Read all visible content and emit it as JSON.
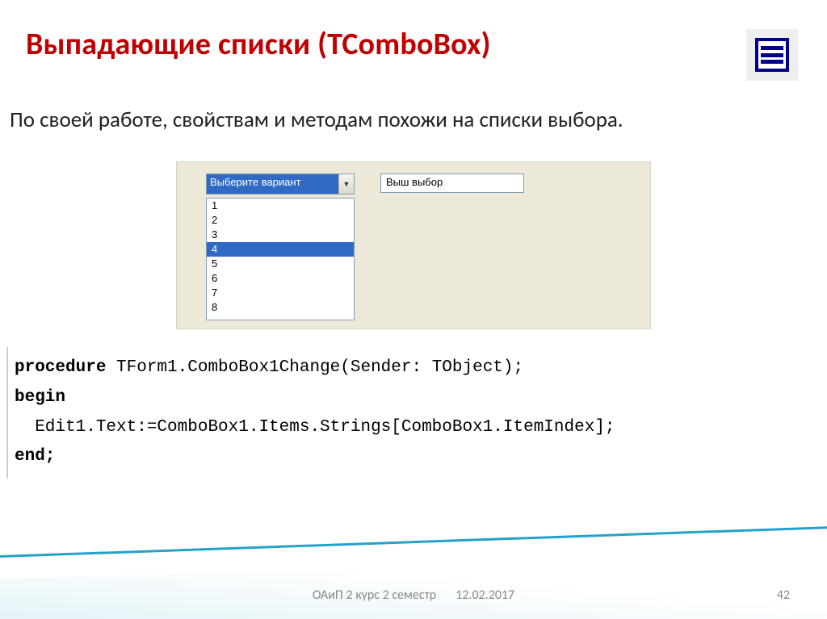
{
  "title": "Выпадающие списки (TComboBox)",
  "description": "По своей работе, свойствам и методам похожи на списки выбора.",
  "combo": {
    "selected": "Выберите вариант",
    "items": [
      "1",
      "2",
      "3",
      "4",
      "5",
      "6",
      "7",
      "8"
    ],
    "highlighted_index": 3
  },
  "edit": {
    "value": "Выш выбор"
  },
  "code": {
    "l1a": "procedure",
    "l1b": " TForm1.ComboBox1Change(Sender: TObject);",
    "l2": "begin",
    "l3": "  Edit1.Text:=ComboBox1.Items.Strings[ComboBox1.ItemIndex];",
    "l4": "end;"
  },
  "footer": {
    "course": "ОАиП 2 курс 2 семестр",
    "date": "12.02.2017",
    "slide": "42"
  }
}
